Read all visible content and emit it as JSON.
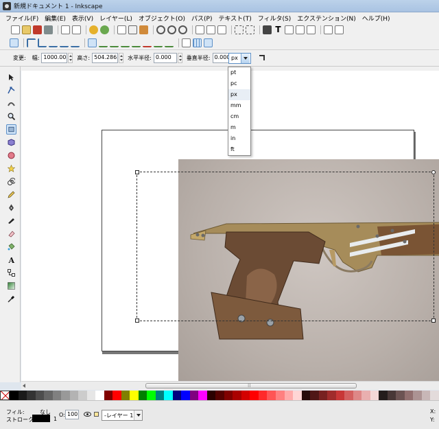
{
  "window": {
    "title": "新規ドキュメント 1 - Inkscape"
  },
  "menu": [
    "ファイル(F)",
    "編集(E)",
    "表示(V)",
    "レイヤー(L)",
    "オブジェクト(O)",
    "パス(P)",
    "テキスト(T)",
    "フィルタ(S)",
    "エクステンション(N)",
    "ヘルプ(H)"
  ],
  "tool_controls": {
    "change_label": "変更:",
    "width_label": "幅:",
    "width_value": "1000.000",
    "height_label": "高さ:",
    "height_value": "504.286",
    "rx_label": "水平半径:",
    "rx_value": "0.000",
    "ry_label": "垂直半径:",
    "ry_value": "0.000",
    "unit_selected": "px"
  },
  "unit_options": [
    "pt",
    "pc",
    "px",
    "mm",
    "cm",
    "m",
    "in",
    "ft"
  ],
  "status": {
    "fill_label": "フィル:",
    "fill_value": "なし",
    "stroke_label": "ストローク:",
    "stroke_width": "1",
    "opacity_label": "O:",
    "opacity_value": "100",
    "layer_name": "-レイヤー 1",
    "x_label": "X:",
    "y_label": "Y:"
  },
  "palette_colors": [
    "#000000",
    "#1a1a1a",
    "#333333",
    "#4d4d4d",
    "#666666",
    "#808080",
    "#999999",
    "#b3b3b3",
    "#cccccc",
    "#e6e6e6",
    "#ffffff",
    "#800000",
    "#ff0000",
    "#808000",
    "#ffff00",
    "#008000",
    "#00ff00",
    "#008080",
    "#00ffff",
    "#000080",
    "#0000ff",
    "#800080",
    "#ff00ff",
    "#2b0000",
    "#550000",
    "#800000",
    "#aa0000",
    "#d40000",
    "#ff0000",
    "#ff2a2a",
    "#ff5555",
    "#ff8080",
    "#ffaaaa",
    "#ffd5d5",
    "#280b0b",
    "#501616",
    "#782121",
    "#a02c2c",
    "#c83737",
    "#d35f5f",
    "#de8787",
    "#e9afaf",
    "#f4d7d7",
    "#241c1c",
    "#483737",
    "#6c5353",
    "#916f6f",
    "#ac9393",
    "#c8b7b7",
    "#e3dbdb"
  ],
  "icons": {
    "app": "inkscape-icon",
    "selected_tool": "rectangle-tool-icon"
  }
}
